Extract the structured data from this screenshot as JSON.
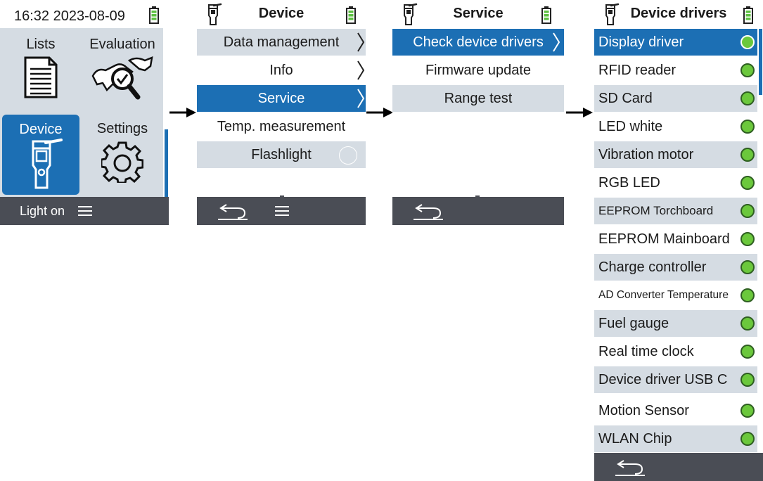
{
  "home": {
    "datetime": "16:32 2023-08-09",
    "tiles": [
      {
        "label": "Lists",
        "icon": "list-document-icon"
      },
      {
        "label": "Evaluation",
        "icon": "evaluation-magnifier-icon"
      },
      {
        "label": "Device",
        "icon": "handheld-device-icon"
      },
      {
        "label": "Settings",
        "icon": "gear-icon"
      }
    ],
    "bottom_label": "Light on",
    "menu_icon": "hamburger-menu-icon"
  },
  "device_menu": {
    "title": "Device",
    "items": [
      {
        "label": "Data management",
        "has_submenu": true
      },
      {
        "label": "Info",
        "has_submenu": true
      },
      {
        "label": "Service",
        "has_submenu": true,
        "selected": true
      },
      {
        "label": "Temp. measurement"
      },
      {
        "label": "Flashlight",
        "toggle": "off"
      }
    ]
  },
  "service_menu": {
    "title": "Service",
    "items": [
      {
        "label": "Check device drivers",
        "has_submenu": true,
        "selected": true
      },
      {
        "label": "Firmware update"
      },
      {
        "label": "Range test"
      }
    ]
  },
  "drivers_menu": {
    "title": "Device drivers",
    "items": [
      {
        "label": "Display driver",
        "status": "ok"
      },
      {
        "label": "RFID reader",
        "status": "ok"
      },
      {
        "label": "SD Card",
        "status": "ok"
      },
      {
        "label": "LED white",
        "status": "ok"
      },
      {
        "label": "Vibration motor",
        "status": "ok"
      },
      {
        "label": "RGB LED",
        "status": "ok"
      },
      {
        "label": "EEPROM Torchboard",
        "status": "ok"
      },
      {
        "label": "EEPROM Mainboard",
        "status": "ok"
      },
      {
        "label": "Charge controller",
        "status": "ok"
      },
      {
        "label": "AD Converter Temperature",
        "status": "ok"
      },
      {
        "label": "Fuel gauge",
        "status": "ok"
      },
      {
        "label": "Real time clock",
        "status": "ok"
      },
      {
        "label": "Device driver USB C",
        "status": "ok"
      },
      {
        "label": "Motion Sensor",
        "status": "ok"
      },
      {
        "label": "WLAN Chip",
        "status": "ok"
      }
    ]
  },
  "colors": {
    "accent": "#1c6fb4",
    "row_grey": "#d5dce3",
    "bottom_bar": "#4a4d55",
    "status_ok": "#6bc83c",
    "battery": "#5cc040"
  }
}
